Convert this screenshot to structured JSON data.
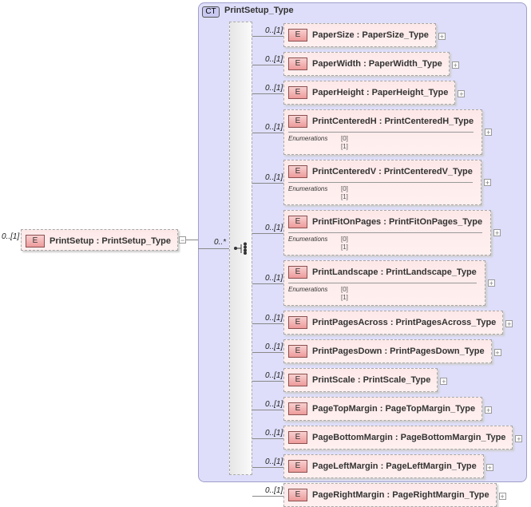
{
  "root": {
    "multiplicity": "0..[1]",
    "badge": "E",
    "name": "PrintSetup : PrintSetup_Type",
    "toggle": "−",
    "seq_multiplicity": "0..*"
  },
  "complex_type": {
    "badge": "CT",
    "name": "PrintSetup_Type"
  },
  "enum_label": "Enumerations",
  "children": [
    {
      "mult": "0..[1]",
      "name": "PaperSize : PaperSize_Type"
    },
    {
      "mult": "0..[1]",
      "name": "PaperWidth : PaperWidth_Type"
    },
    {
      "mult": "0..[1]",
      "name": "PaperHeight : PaperHeight_Type"
    },
    {
      "mult": "0..[1]",
      "name": "PrintCenteredH : PrintCenteredH_Type",
      "enums": [
        "[0]",
        "[1]"
      ]
    },
    {
      "mult": "0..[1]",
      "name": "PrintCenteredV : PrintCenteredV_Type",
      "enums": [
        "[0]",
        "[1]"
      ]
    },
    {
      "mult": "0..[1]",
      "name": "PrintFitOnPages : PrintFitOnPages_Type",
      "enums": [
        "[0]",
        "[1]"
      ]
    },
    {
      "mult": "0..[1]",
      "name": "PrintLandscape : PrintLandscape_Type",
      "enums": [
        "[0]",
        "[1]"
      ]
    },
    {
      "mult": "0..[1]",
      "name": "PrintPagesAcross : PrintPagesAcross_Type"
    },
    {
      "mult": "0..[1]",
      "name": "PrintPagesDown : PrintPagesDown_Type"
    },
    {
      "mult": "0..[1]",
      "name": "PrintScale : PrintScale_Type"
    },
    {
      "mult": "0..[1]",
      "name": "PageTopMargin : PageTopMargin_Type"
    },
    {
      "mult": "0..[1]",
      "name": "PageBottomMargin : PageBottomMargin_Type"
    },
    {
      "mult": "0..[1]",
      "name": "PageLeftMargin : PageLeftMargin_Type"
    },
    {
      "mult": "0..[1]",
      "name": "PageRightMargin : PageRightMargin_Type"
    }
  ]
}
